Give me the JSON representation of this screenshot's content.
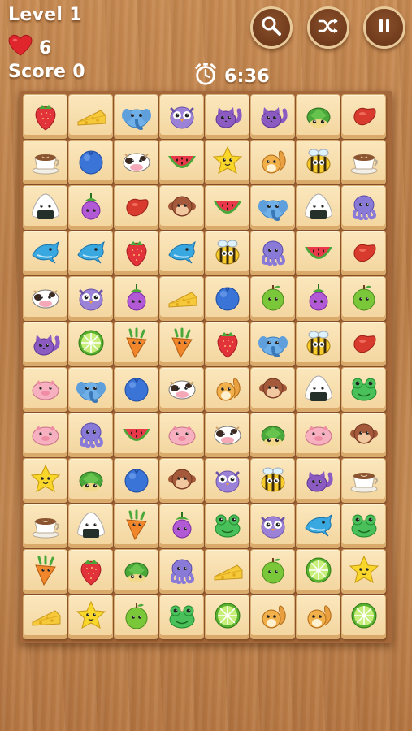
{
  "hud": {
    "level_text": "Level 1",
    "lives": "6",
    "score_text": "Score 0",
    "timer": "6:36"
  },
  "buttons": {
    "hint": "magnifier-icon",
    "shuffle": "shuffle-icon",
    "pause": "pause-icon"
  },
  "colors": {
    "heart": "#e0262d",
    "button_bg": "#7a4322",
    "button_border": "#e8c99a",
    "tile_face": "#f8e0b0"
  },
  "board": {
    "rows": 12,
    "cols": 8,
    "tiles": [
      [
        "strawberry",
        "cheese",
        "elephant",
        "owl",
        "cat",
        "cat",
        "turtle",
        "bean"
      ],
      [
        "coffee",
        "blueberry",
        "cow",
        "watermelon",
        "star",
        "squirrel",
        "bee",
        "coffee"
      ],
      [
        "onigiri",
        "eggplant",
        "bean",
        "monkey",
        "watermelon",
        "elephant",
        "onigiri",
        "octopus"
      ],
      [
        "dolphin",
        "dolphin",
        "strawberry",
        "dolphin",
        "bee",
        "octopus",
        "watermelon",
        "bean"
      ],
      [
        "cow",
        "owl",
        "eggplant",
        "cheese",
        "blueberry",
        "apple",
        "eggplant",
        "apple"
      ],
      [
        "cat",
        "lime",
        "carrot",
        "carrot",
        "strawberry",
        "elephant",
        "bee",
        "bean"
      ],
      [
        "pig",
        "elephant",
        "blueberry",
        "cow",
        "squirrel",
        "monkey",
        "onigiri",
        "frog"
      ],
      [
        "pig",
        "octopus",
        "watermelon",
        "pig",
        "cow",
        "turtle",
        "pig",
        "monkey"
      ],
      [
        "star",
        "turtle",
        "blueberry",
        "monkey",
        "owl",
        "bee",
        "cat",
        "coffee"
      ],
      [
        "coffee",
        "onigiri",
        "carrot",
        "eggplant",
        "frog",
        "owl",
        "dolphin",
        "frog"
      ],
      [
        "carrot",
        "strawberry",
        "turtle",
        "octopus",
        "cheese",
        "apple",
        "lime",
        "star"
      ],
      [
        "cheese",
        "star",
        "apple",
        "frog",
        "lime",
        "squirrel",
        "squirrel",
        "lime"
      ]
    ]
  }
}
